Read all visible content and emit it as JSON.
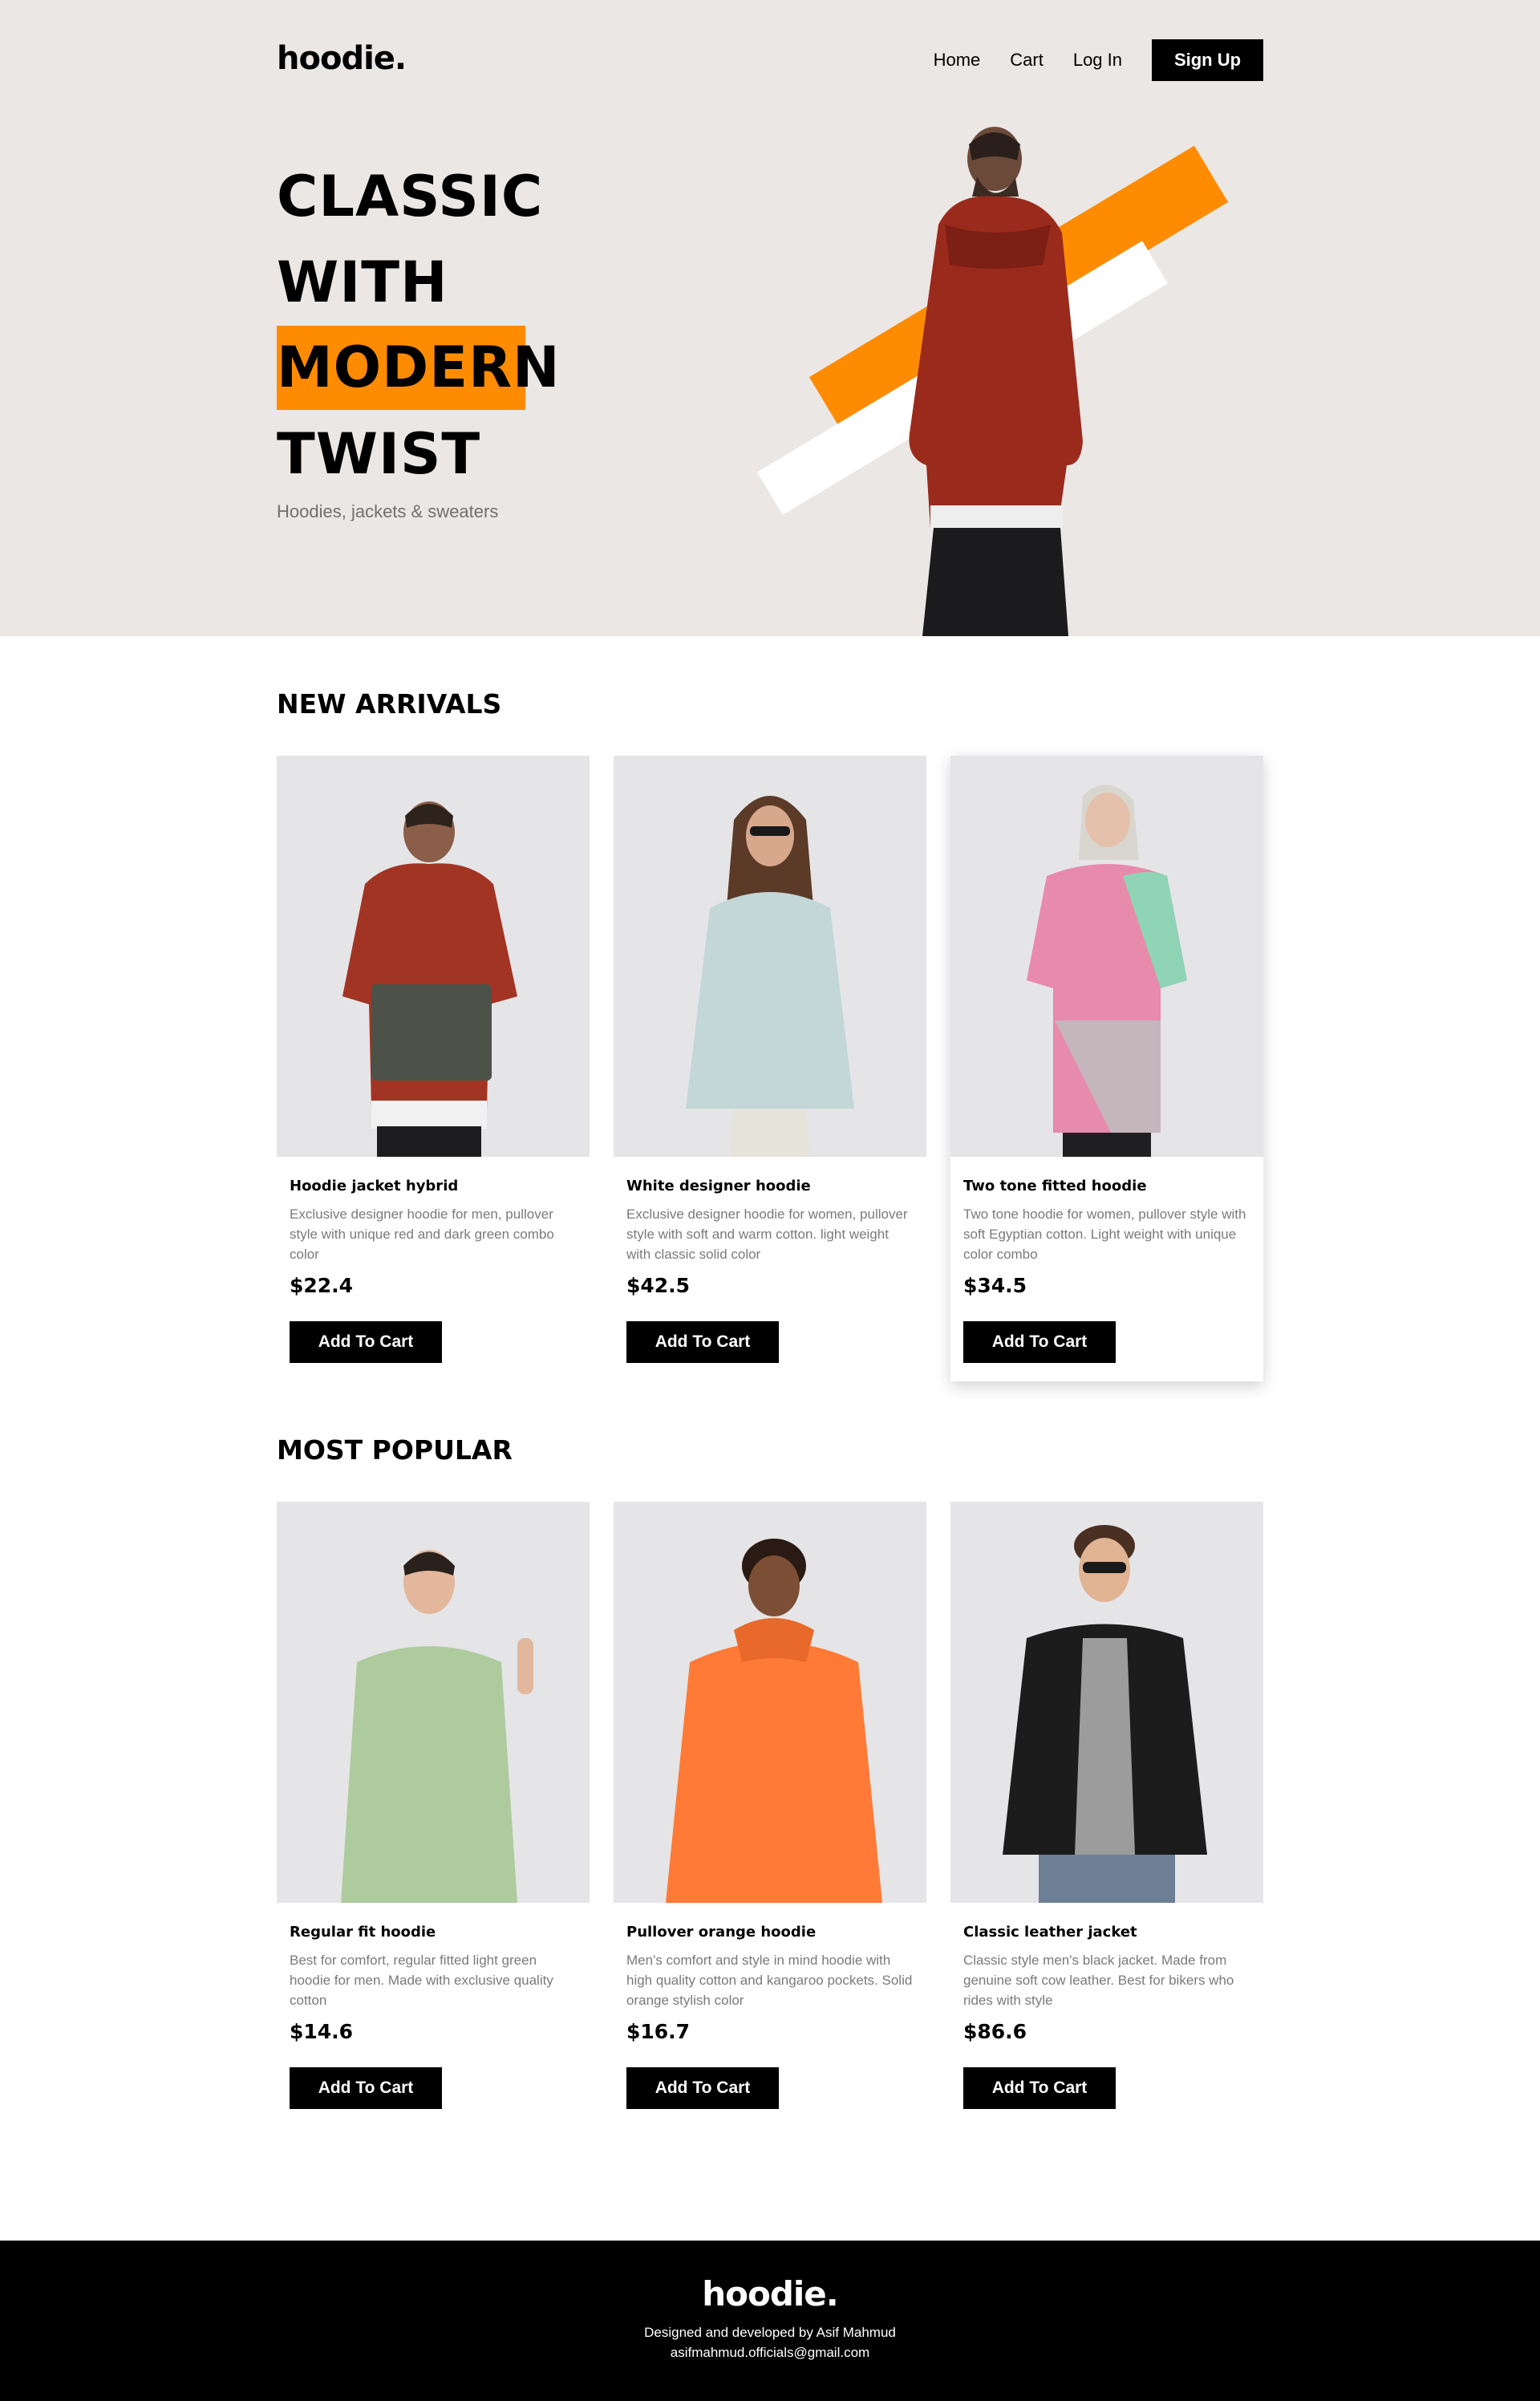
{
  "header": {
    "logo": "hoodie.",
    "nav": {
      "home": "Home",
      "cart": "Cart",
      "login": "Log In",
      "signup": "Sign Up"
    }
  },
  "hero": {
    "line1": "CLASSIC",
    "line2": "WITH",
    "line3": "MODERN",
    "line4": "TWIST",
    "subtitle": "Hoodies, jackets & sweaters"
  },
  "colors": {
    "accent": "#ff8c00",
    "hero_bg": "#ebe7e5",
    "card_photo_bg": "#e5e5e8"
  },
  "new_arrivals": {
    "title": "NEW ARRIVALS",
    "items": [
      {
        "name": "Hoodie jacket hybrid",
        "desc": "Exclusive designer hoodie for men, pullover style with unique red and dark green combo color",
        "price": "$22.4",
        "button": "Add To Cart"
      },
      {
        "name": "White designer hoodie",
        "desc": "Exclusive designer hoodie for women, pullover style with soft and warm cotton. light weight with classic solid color",
        "price": "$42.5",
        "button": "Add To Cart"
      },
      {
        "name": "Two tone fitted hoodie",
        "desc": "Two tone hoodie for women, pullover style with soft Egyptian cotton. Light weight with unique color combo",
        "price": "$34.5",
        "button": "Add To Cart"
      }
    ]
  },
  "most_popular": {
    "title": "MOST POPULAR",
    "items": [
      {
        "name": "Regular fit hoodie",
        "desc": "Best for comfort, regular fitted light green hoodie for men. Made with exclusive quality cotton",
        "price": "$14.6",
        "button": "Add To Cart"
      },
      {
        "name": "Pullover orange hoodie",
        "desc": "Men's comfort and style in mind hoodie with high quality cotton and kangaroo pockets. Solid orange stylish color",
        "price": "$16.7",
        "button": "Add To Cart"
      },
      {
        "name": "Classic leather jacket",
        "desc": "Classic style men's black jacket. Made from genuine soft cow leather. Best for bikers who rides with style",
        "price": "$86.6",
        "button": "Add To Cart"
      }
    ]
  },
  "footer": {
    "logo": "hoodie.",
    "credit": "Designed and developed by Asif Mahmud",
    "email": "asifmahmud.officials@gmail.com"
  }
}
